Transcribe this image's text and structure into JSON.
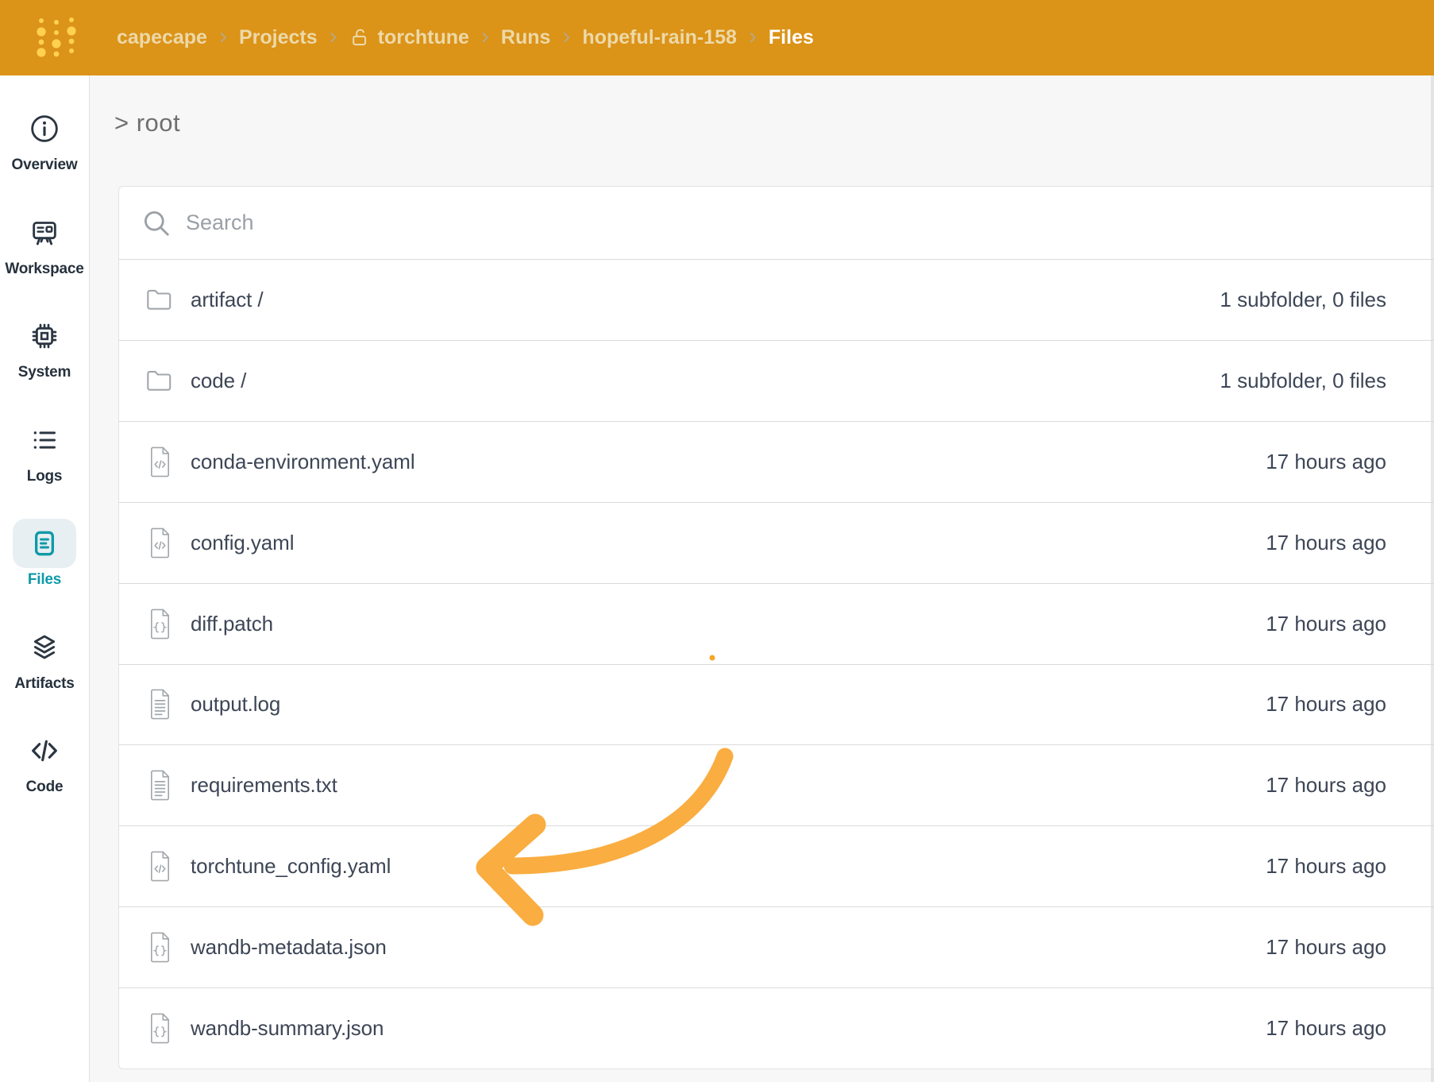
{
  "app": {
    "header_bg": "#DB9318",
    "accent_teal": "#0E9AA8",
    "logo_dot_color": "#FFD14F"
  },
  "header": {
    "separator": "›",
    "breadcrumb": [
      {
        "label": "capecape"
      },
      {
        "label": "Projects"
      },
      {
        "label": "torchtune",
        "icon": "lock-open-icon"
      },
      {
        "label": "Runs"
      },
      {
        "label": "hopeful-rain-158"
      },
      {
        "label": "Files",
        "current": true
      }
    ]
  },
  "sidebar": {
    "items": [
      {
        "label": "Overview",
        "icon": "info-icon"
      },
      {
        "label": "Workspace",
        "icon": "workspace-icon"
      },
      {
        "label": "System",
        "icon": "system-icon"
      },
      {
        "label": "Logs",
        "icon": "logs-icon"
      },
      {
        "label": "Files",
        "icon": "files-icon",
        "active": true
      },
      {
        "label": "Artifacts",
        "icon": "artifacts-icon"
      },
      {
        "label": "Code",
        "icon": "code-icon"
      }
    ]
  },
  "main": {
    "path_heading": "> root",
    "search_placeholder": "Search",
    "files": [
      {
        "name": "artifact /",
        "type": "folder",
        "icon": "folder-icon",
        "meta": "1 subfolder, 0 files"
      },
      {
        "name": "code /",
        "type": "folder",
        "icon": "folder-icon",
        "meta": "1 subfolder, 0 files"
      },
      {
        "name": "conda-environment.yaml",
        "type": "code",
        "icon": "code-file-icon",
        "meta": "17 hours ago"
      },
      {
        "name": "config.yaml",
        "type": "code",
        "icon": "code-file-icon",
        "meta": "17 hours ago"
      },
      {
        "name": "diff.patch",
        "type": "json",
        "icon": "json-file-icon",
        "meta": "17 hours ago"
      },
      {
        "name": "output.log",
        "type": "text",
        "icon": "text-file-icon",
        "meta": "17 hours ago"
      },
      {
        "name": "requirements.txt",
        "type": "text",
        "icon": "text-file-icon",
        "meta": "17 hours ago"
      },
      {
        "name": "torchtune_config.yaml",
        "type": "code",
        "icon": "code-file-icon",
        "meta": "17 hours ago"
      },
      {
        "name": "wandb-metadata.json",
        "type": "json",
        "icon": "json-file-icon",
        "meta": "17 hours ago"
      },
      {
        "name": "wandb-summary.json",
        "type": "json",
        "icon": "json-file-icon",
        "meta": "17 hours ago"
      }
    ]
  },
  "annotation": {
    "arrow_color": "#FAAD40",
    "dot_color": "#F5A623"
  }
}
